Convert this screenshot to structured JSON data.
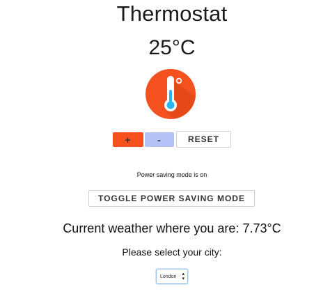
{
  "header": {
    "title": "Thermostat",
    "temperature": "25°C"
  },
  "thermometer_icon": {
    "icon": "thermometer-icon",
    "circle_color": "#f4511e",
    "tube_color": "#ffffff",
    "mercury_color": "#29b6f6"
  },
  "controls": {
    "increase_label": "+",
    "increase_color": "#f4511e",
    "decrease_label": "-",
    "decrease_color": "#b3c3f7",
    "reset_label": "RESET"
  },
  "power_saving": {
    "status_text": "Power saving mode is on",
    "toggle_label": "TOGGLE POWER SAVING MODE"
  },
  "weather": {
    "text": "Current weather where you are: 7.73°C"
  },
  "city": {
    "label": "Please select your city:",
    "selected": "London"
  }
}
